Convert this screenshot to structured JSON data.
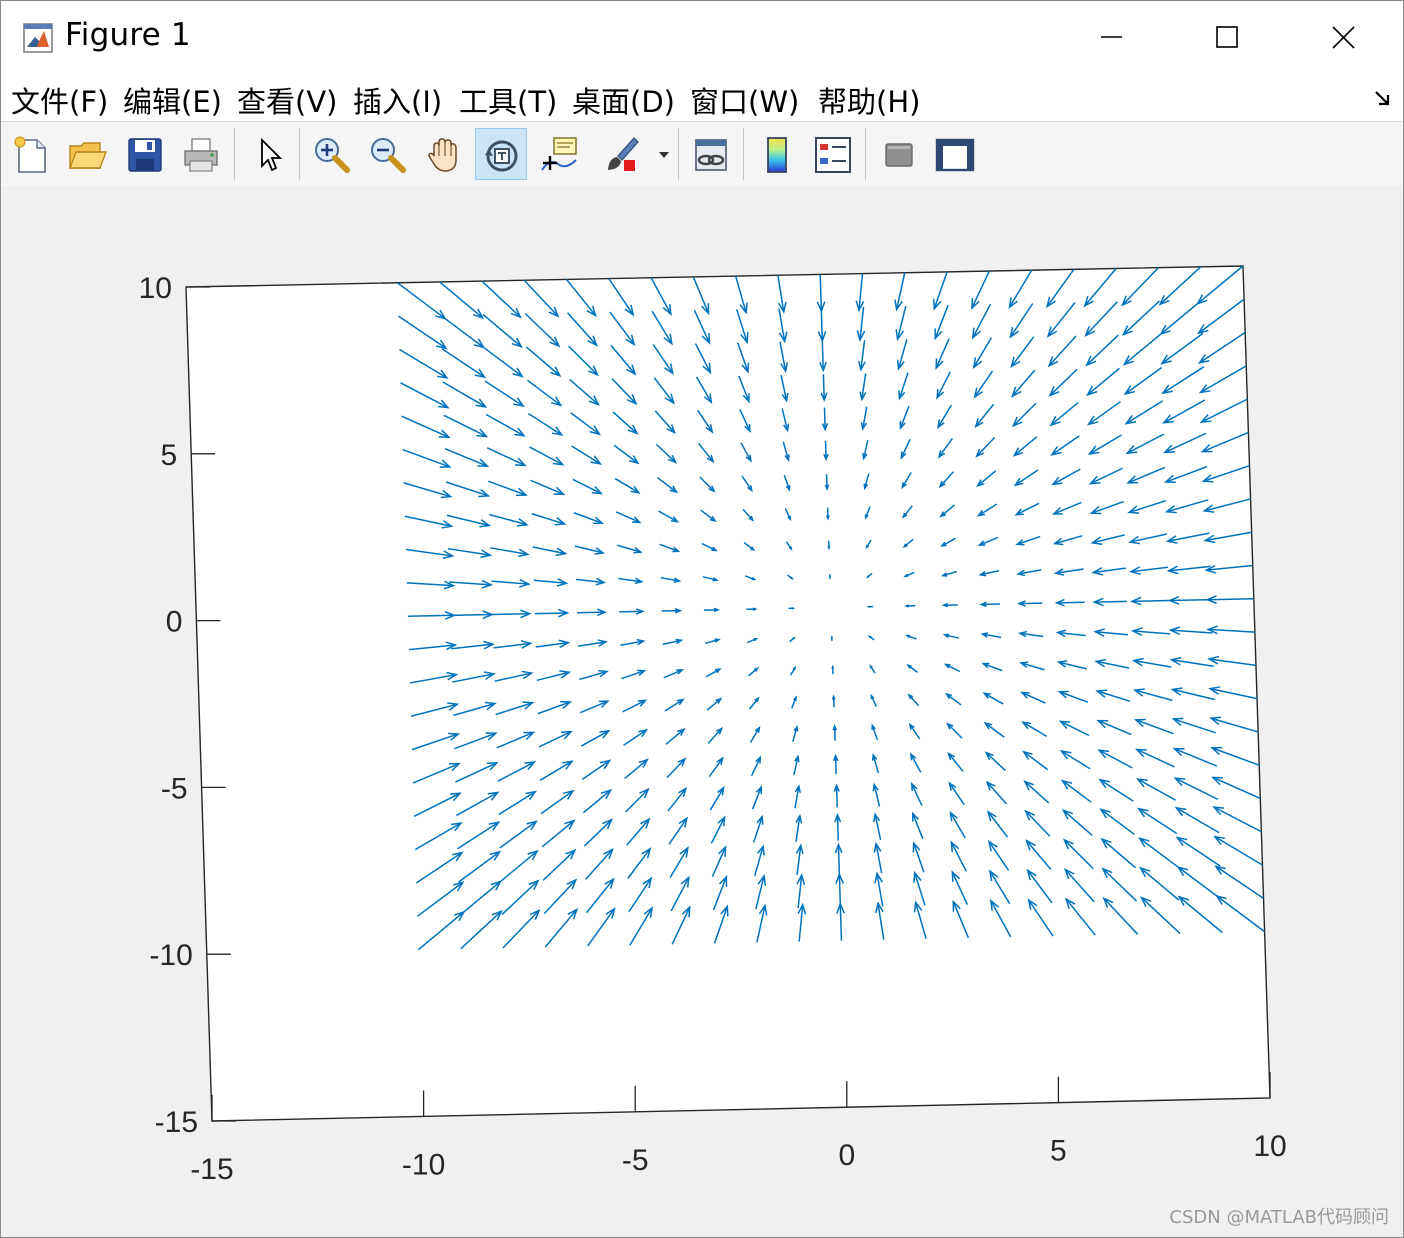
{
  "window": {
    "title": "Figure 1",
    "controls": [
      "minimize",
      "maximize",
      "close"
    ]
  },
  "menu": {
    "items": [
      "文件(F)",
      "编辑(E)",
      "查看(V)",
      "插入(I)",
      "工具(T)",
      "桌面(D)",
      "窗口(W)",
      "帮助(H)"
    ]
  },
  "toolbar": {
    "buttons": [
      {
        "icon": "new-figure-icon"
      },
      {
        "icon": "open-file-icon"
      },
      {
        "icon": "save-icon"
      },
      {
        "icon": "print-icon"
      },
      {
        "icon": "edit-plot-arrow-icon"
      },
      {
        "icon": "zoom-in-icon"
      },
      {
        "icon": "zoom-out-icon"
      },
      {
        "icon": "pan-hand-icon"
      },
      {
        "icon": "rotate-3d-icon",
        "active": true
      },
      {
        "icon": "data-cursor-icon"
      },
      {
        "icon": "brush-icon"
      },
      {
        "icon": "link-plot-icon"
      },
      {
        "icon": "colorbar-icon"
      },
      {
        "icon": "legend-icon"
      },
      {
        "icon": "hide-plot-tools-icon"
      },
      {
        "icon": "show-plot-tools-icon"
      }
    ]
  },
  "chart_data": {
    "type": "quiver",
    "title": "",
    "xlabel": "",
    "ylabel": "",
    "view": "3d-rotated",
    "xlim": [
      -15,
      10
    ],
    "ylim": [
      -15,
      10
    ],
    "xticks": [
      "-15",
      "-10",
      "-5",
      "0",
      "5",
      "10"
    ],
    "yticks": [
      "10",
      "5",
      "0",
      "-5",
      "-10",
      "-15"
    ],
    "grid": {
      "x_from": -10,
      "x_to": 10,
      "x_step": 1,
      "y_from": -10,
      "y_to": 10,
      "y_step": 1
    },
    "field": "u = -x, v = -y (vectors point toward origin, autoscaled)",
    "series": [
      {
        "color": "#0072bd"
      }
    ]
  },
  "watermark": "CSDN @MATLAB代码顾问"
}
